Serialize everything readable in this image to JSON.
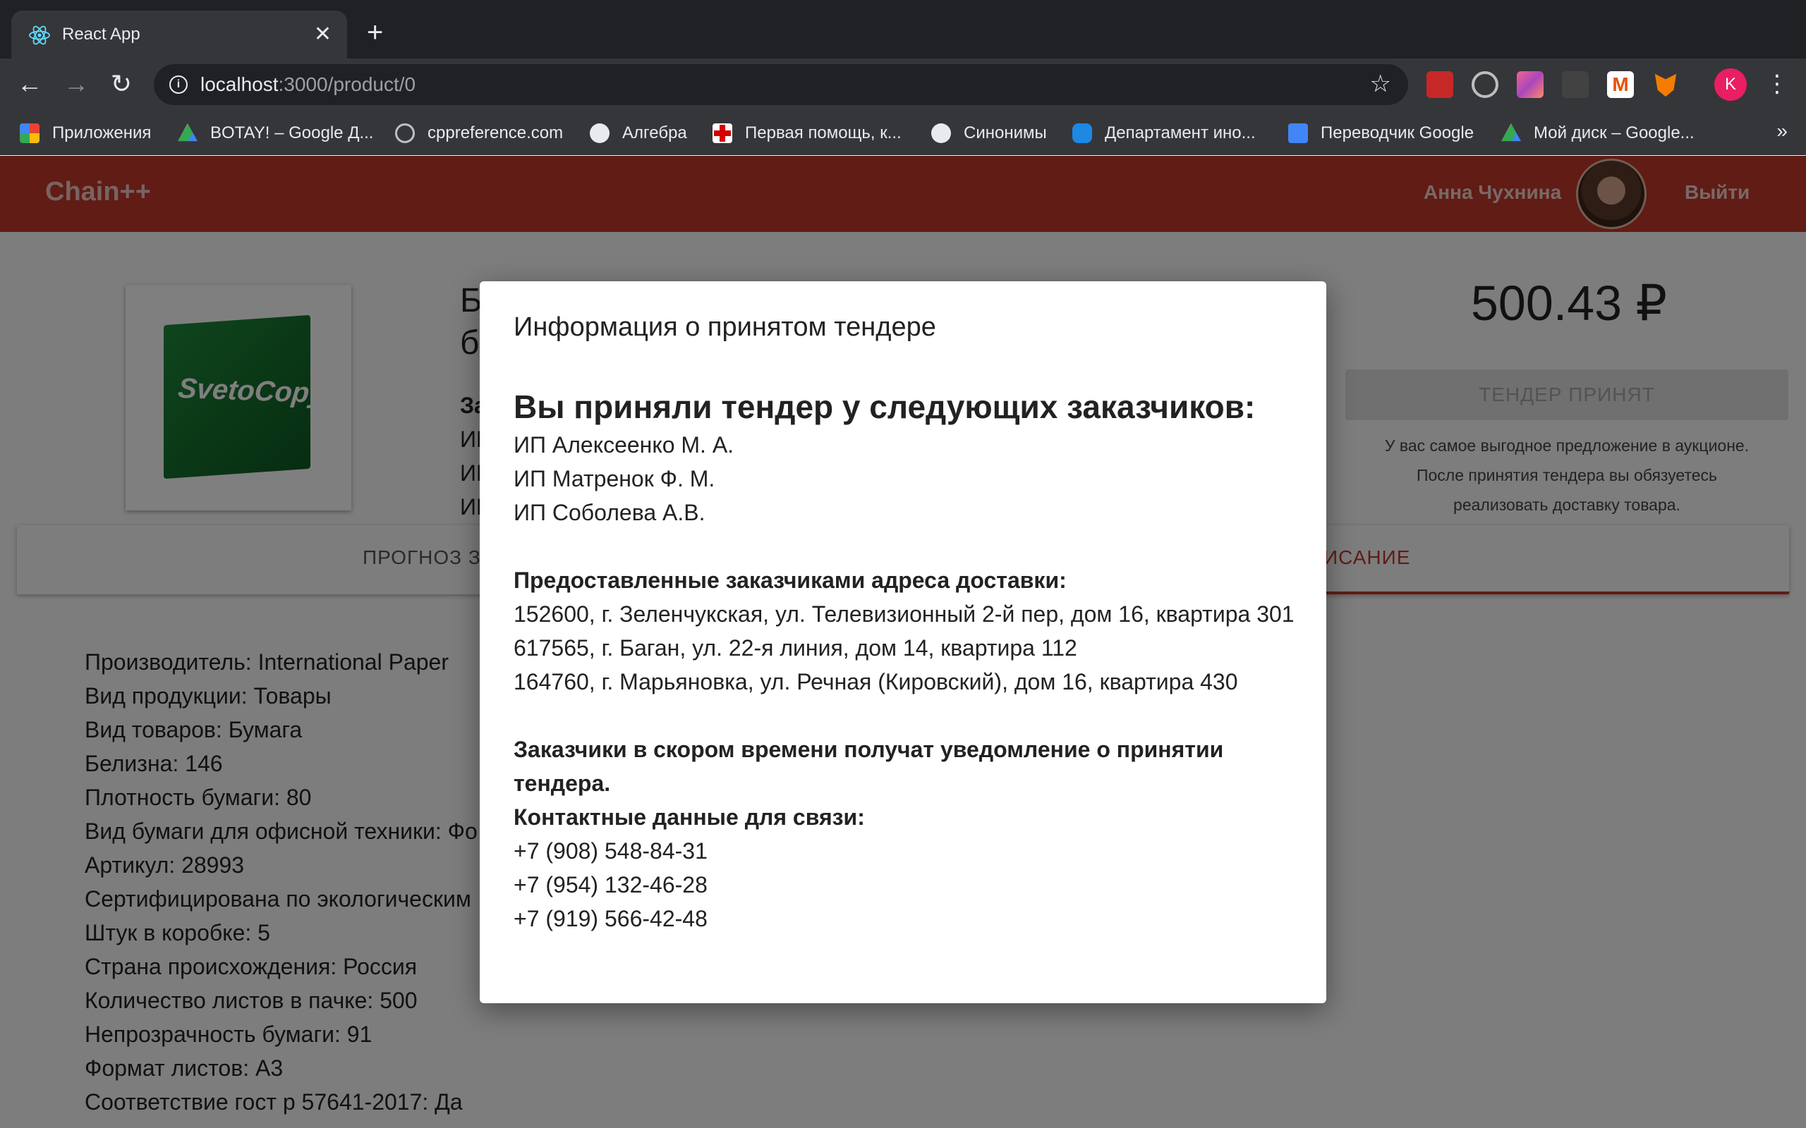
{
  "browser": {
    "tab_title": "React App",
    "url_host": "localhost",
    "url_path": ":3000/product/0",
    "profile_initial": "K",
    "bookmarks": [
      {
        "label": "Приложения",
        "icon": "apps-grid-icon"
      },
      {
        "label": "BOTAY! – Google Д...",
        "icon": "google-drive-icon"
      },
      {
        "label": "cppreference.com",
        "icon": "cppreference-icon"
      },
      {
        "label": "Алгебра",
        "icon": "globe-icon"
      },
      {
        "label": "Первая помощь, к...",
        "icon": "red-cross-icon"
      },
      {
        "label": "Синонимы",
        "icon": "globe-icon"
      },
      {
        "label": "Департамент ино...",
        "icon": "department-icon"
      },
      {
        "label": "Переводчик Google",
        "icon": "google-translate-icon"
      },
      {
        "label": "Мой диск – Google...",
        "icon": "google-drive-icon"
      }
    ]
  },
  "app": {
    "brand": "Chain++",
    "user_name": "Анна Чухнина",
    "logout_label": "Выйти"
  },
  "product": {
    "title_frag_1": "Б",
    "title_frag_2": "б",
    "left_frags": [
      "За",
      "ИП",
      "ИП",
      "ИП"
    ],
    "box_label": "SvetoCopy",
    "price": "500.43 ₽",
    "tender_button": "ТЕНДЕР ПРИНЯТ",
    "notice_lines": [
      "У вас самое выгодное предложение в аукционе.",
      "После принятия тендера вы обязуетесь",
      "реализовать доставку товара."
    ],
    "tab_left": "ПРОГНОЗ ЗА",
    "tab_right": "ИСАНИЕ",
    "specs": [
      "Производитель: International Paper",
      "Вид продукции: Товары",
      "Вид товаров: Бумага",
      "Белизна: 146",
      "Плотность бумаги: 80",
      "Вид бумаги для офисной техники: Фо",
      "Артикул: 28993",
      "Сертифицирована по экологическим",
      "Штук в коробке: 5",
      "Страна происхождения: Россия",
      "Количество листов в пачке: 500",
      "Непрозрачность бумаги: 91",
      "Формат листов: А3",
      "Соответствие гост р 57641-2017: Да"
    ]
  },
  "modal": {
    "title": "Информация о принятом тендере",
    "heading": "Вы приняли тендер у следующих заказчиков:",
    "customers": [
      "ИП Алексеенко М. А.",
      "ИП Матренок Ф. М.",
      "ИП Соболева А.В."
    ],
    "addresses_heading": "Предоставленные заказчиками адреса доставки:",
    "addresses": [
      "152600, г. Зеленчукская, ул. Телевизионный 2-й пер, дом 16, квартира 301",
      "617565, г. Баган, ул. 22-я линия, дом 14, квартира 112",
      "164760, г. Марьяновка, ул. Речная (Кировский), дом 16, квартира 430"
    ],
    "notify_text": "Заказчики в скором времени получат уведомление о принятии тендера.",
    "contacts_heading": "Контактные данные для связи:",
    "phones": [
      "+7 (908) 548-84-31",
      "+7 (954) 132-46-28",
      "+7 (919) 566-42-48"
    ]
  },
  "colors": {
    "appbar": "#c0392b",
    "accent": "#c0392b",
    "browser_dark": "#202124",
    "browser_toolbar": "#35363a"
  }
}
